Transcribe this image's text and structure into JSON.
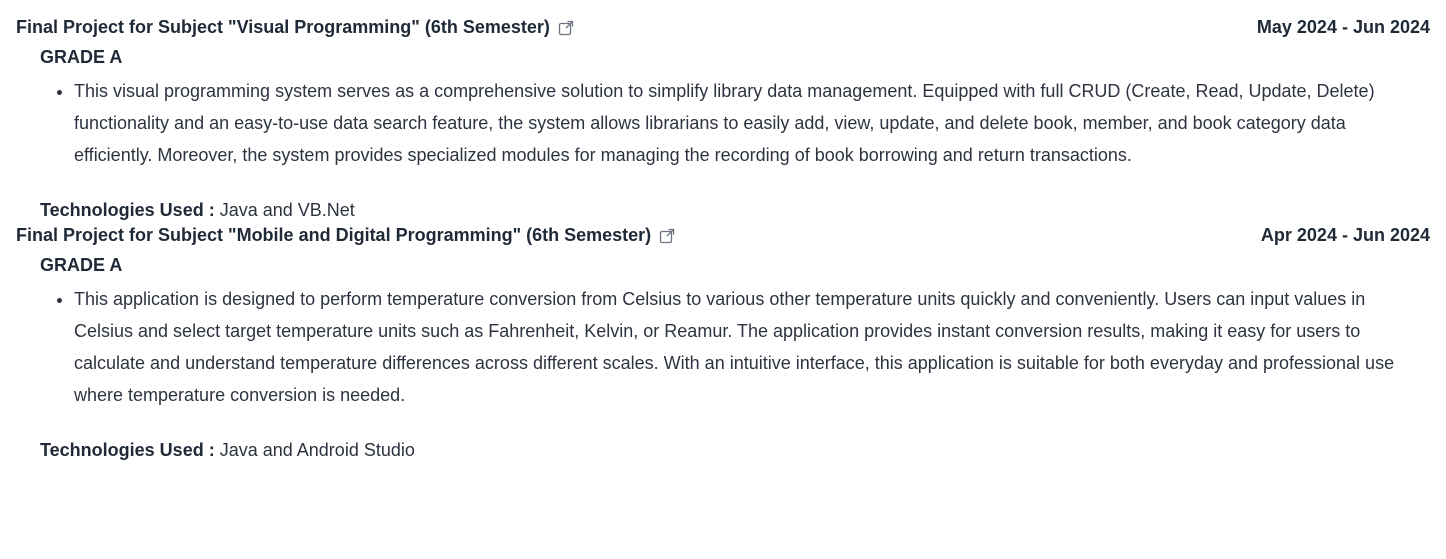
{
  "projects": [
    {
      "title": "Final Project for Subject \"Visual Programming\" (6th Semester)",
      "date": "May 2024 - Jun 2024",
      "grade": "GRADE A",
      "description": "This visual programming system serves as a comprehensive solution to simplify library data management. Equipped with full CRUD (Create, Read, Update, Delete) functionality and an easy-to-use data search feature, the system allows librarians to easily add, view, update, and delete book, member, and book category data efficiently. Moreover, the system provides specialized modules for managing the recording of book borrowing and return transactions.",
      "tech_label": "Technologies Used :",
      "tech_value": "Java and VB.Net",
      "link_icon": "external-link-icon"
    },
    {
      "title": "Final Project for Subject \"Mobile and Digital Programming\" (6th Semester)",
      "date": "Apr 2024 - Jun 2024",
      "grade": "GRADE A",
      "description": "This application is designed to perform temperature conversion from Celsius to various other temperature units quickly and conveniently. Users can input values in Celsius and select target temperature units such as Fahrenheit, Kelvin, or Reamur. The application provides instant conversion results, making it easy for users to calculate and understand temperature differences across different scales. With an intuitive interface, this application is suitable for both everyday and professional use where temperature conversion is needed.",
      "tech_label": "Technologies Used :",
      "tech_value": "Java and Android Studio",
      "link_icon": "external-link-icon"
    }
  ],
  "colors": {
    "heading": "#1f2937",
    "body_text": "#2d3340",
    "icon": "#6b7280"
  }
}
